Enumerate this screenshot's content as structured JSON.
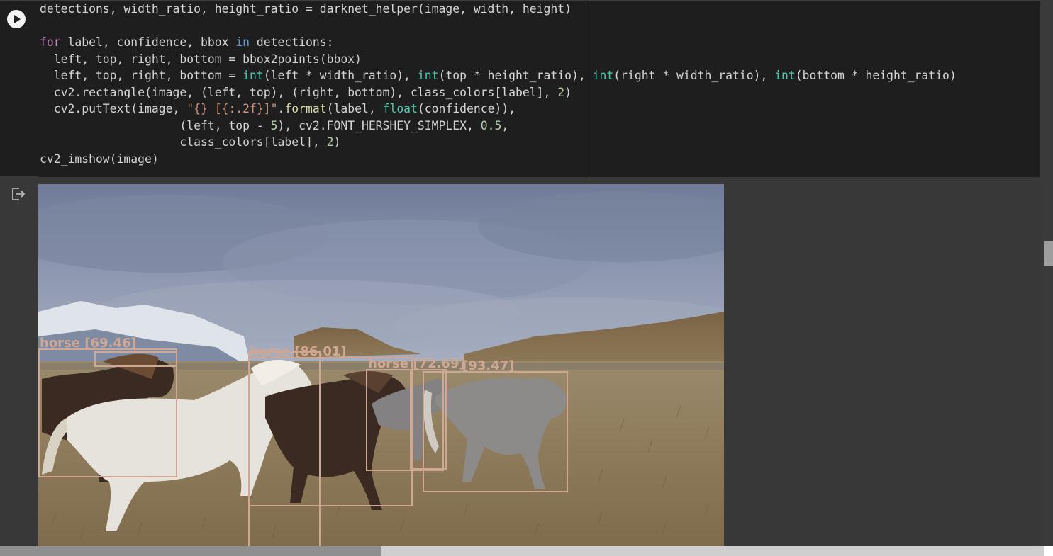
{
  "code_cell": {
    "lines": [
      [
        {
          "t": "detections, width_ratio, height_ratio = darknet_helper(image, width, height)",
          "c": ""
        }
      ],
      [
        {
          "t": "",
          "c": ""
        }
      ],
      [
        {
          "t": "for",
          "c": "kw"
        },
        {
          "t": " label, confidence, bbox ",
          "c": ""
        },
        {
          "t": "in",
          "c": "kb"
        },
        {
          "t": " detections:",
          "c": ""
        }
      ],
      [
        {
          "t": "  left, top, right, bottom = bbox2points(bbox)",
          "c": ""
        }
      ],
      [
        {
          "t": "  left, top, right, bottom = ",
          "c": ""
        },
        {
          "t": "int",
          "c": "bi"
        },
        {
          "t": "(left * width_ratio), ",
          "c": ""
        },
        {
          "t": "int",
          "c": "bi"
        },
        {
          "t": "(top * height_ratio), ",
          "c": ""
        },
        {
          "t": "int",
          "c": "bi"
        },
        {
          "t": "(right * width_ratio), ",
          "c": ""
        },
        {
          "t": "int",
          "c": "bi"
        },
        {
          "t": "(bottom * height_ratio)",
          "c": ""
        }
      ],
      [
        {
          "t": "  cv2.rectangle(image, (left, top), (right, bottom), class_colors[label], ",
          "c": ""
        },
        {
          "t": "2",
          "c": "nm"
        },
        {
          "t": ")",
          "c": ""
        }
      ],
      [
        {
          "t": "  cv2.putText(image, ",
          "c": ""
        },
        {
          "t": "\"{} [{:.2f}]\"",
          "c": "st"
        },
        {
          "t": ".",
          "c": ""
        },
        {
          "t": "format",
          "c": "fn"
        },
        {
          "t": "(label, ",
          "c": ""
        },
        {
          "t": "float",
          "c": "bi"
        },
        {
          "t": "(confidence)),",
          "c": ""
        }
      ],
      [
        {
          "t": "                    (left, top - ",
          "c": ""
        },
        {
          "t": "5",
          "c": "nm"
        },
        {
          "t": "), cv2.FONT_HERSHEY_SIMPLEX, ",
          "c": ""
        },
        {
          "t": "0.5",
          "c": "nm"
        },
        {
          "t": ",",
          "c": ""
        }
      ],
      [
        {
          "t": "                    class_colors[label], ",
          "c": ""
        },
        {
          "t": "2",
          "c": "nm"
        },
        {
          "t": ")",
          "c": ""
        }
      ],
      [
        {
          "t": "cv2_imshow(image)",
          "c": ""
        }
      ]
    ]
  },
  "detections": [
    {
      "label": "horse [69.46]"
    },
    {
      "label": "horse [86.01]"
    },
    {
      "label": "horse [72.69]"
    },
    {
      "label": "[93.47]"
    }
  ],
  "colors": {
    "box": "#cfa793",
    "cell_bg": "#1e1e1e",
    "page_bg": "#383838"
  }
}
